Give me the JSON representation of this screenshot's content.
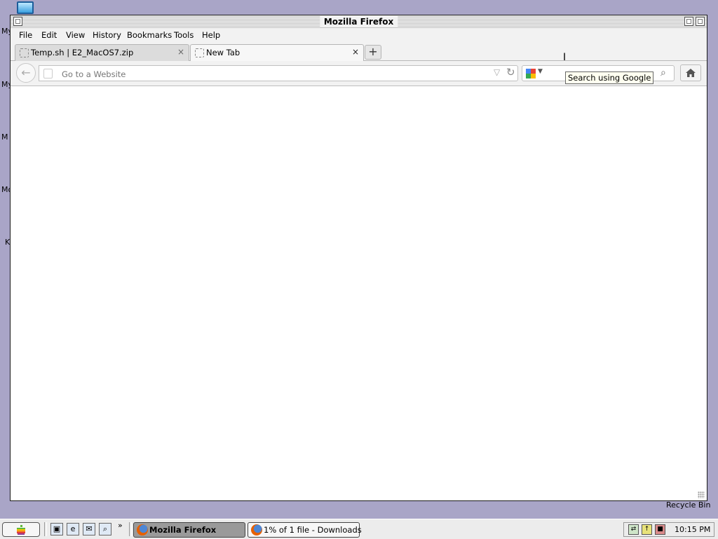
{
  "desktop": {
    "side_labels": [
      "My",
      "My",
      "M",
      "Mo",
      "K"
    ],
    "recycle_label": "Recycle Bin"
  },
  "window": {
    "title": "Mozilla Firefox"
  },
  "menu": [
    "File",
    "Edit",
    "View",
    "History",
    "Bookmarks",
    "Tools",
    "Help"
  ],
  "tabs": [
    {
      "label": "Temp.sh | E2_MacOS7.zip",
      "close": "×",
      "active": false
    },
    {
      "label": "New Tab",
      "close": "×",
      "active": true
    }
  ],
  "new_tab_glyph": "+",
  "urlbar": {
    "placeholder": "Go to a Website",
    "value": ""
  },
  "searchbar": {
    "engine_icon": "google-icon",
    "value": "",
    "tooltip": "Search using Google"
  },
  "taskbar": {
    "start_glyph": "",
    "quick_launch_more": "»",
    "tasks": [
      {
        "label": "Mozilla Firefox",
        "active": true
      },
      {
        "label": "1% of 1 file - Downloads",
        "active": false
      }
    ],
    "clock": "10:15 PM"
  }
}
